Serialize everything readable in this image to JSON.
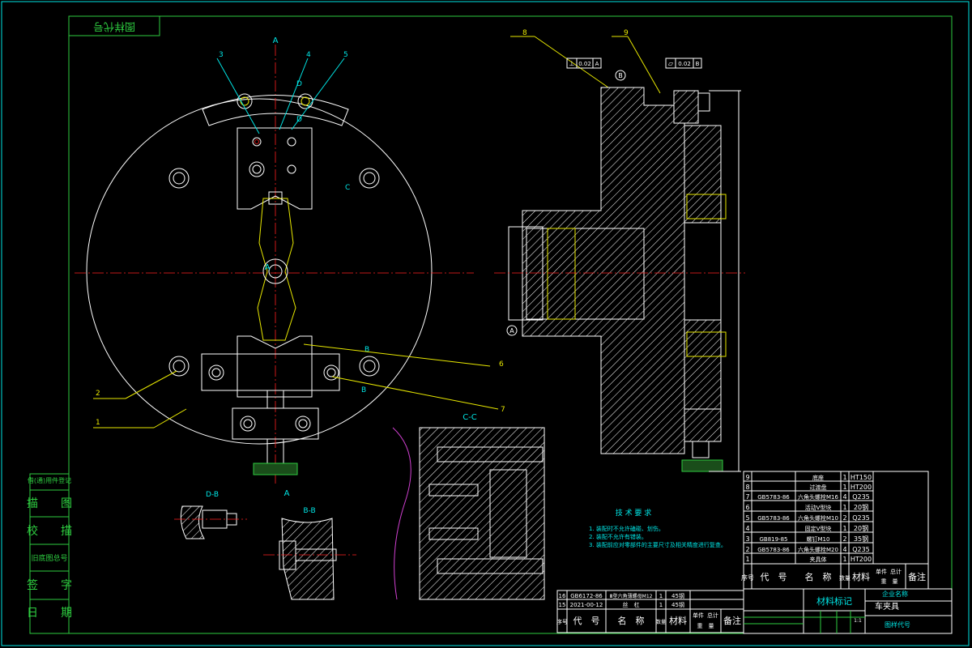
{
  "title_stamp": "图样代号",
  "view_labels": {
    "a_top": "A",
    "a_bottom": "A",
    "a_center": "A",
    "d_upper": "D",
    "d_lower": "D",
    "c_mark": "C",
    "b_upper": "B",
    "b_lower": "B",
    "section_cc": "C-C",
    "section_bb": "B-B",
    "section_db": "D-B",
    "datum_b": "B",
    "datum_a": "A"
  },
  "balloons": [
    "1",
    "2",
    "3",
    "4",
    "5",
    "6",
    "7",
    "8",
    "9"
  ],
  "tolerance_frames": [
    {
      "symbol": "⊥",
      "value": "0.02",
      "datum": "A"
    },
    {
      "symbol": "▱",
      "value": "0.02",
      "datum": "B"
    }
  ],
  "left_column": [
    {
      "label": "借(通)用件登记"
    },
    {
      "label": "描　　图"
    },
    {
      "label": "校　　描"
    },
    {
      "label": "旧底图总号"
    },
    {
      "label": "签　　字"
    },
    {
      "label": "日　　期"
    }
  ],
  "tech_req": {
    "heading": "技 术 要 求",
    "items": [
      "1. 装配时不允许磕碰、划伤。",
      "2. 装配不允许有错装。",
      "3. 装配前应对零部件的主要尺寸及相关精度进行复查。"
    ]
  },
  "bom_main": {
    "rows": [
      {
        "no": "9",
        "code": "",
        "name": "底座",
        "qty": "1",
        "material": "HT150"
      },
      {
        "no": "8",
        "code": "",
        "name": "过渡盘",
        "qty": "1",
        "material": "HT200"
      },
      {
        "no": "7",
        "code": "GB5783-86",
        "name": "六角头螺栓M16",
        "qty": "4",
        "material": "Q235"
      },
      {
        "no": "6",
        "code": "",
        "name": "活动V型块",
        "qty": "1",
        "material": "20钢"
      },
      {
        "no": "5",
        "code": "GB5783-86",
        "name": "六角头螺栓M10",
        "qty": "2",
        "material": "Q235"
      },
      {
        "no": "4",
        "code": "",
        "name": "固定V型块",
        "qty": "1",
        "material": "20钢"
      },
      {
        "no": "3",
        "code": "GB819-85",
        "name": "螺钉M10",
        "qty": "2",
        "material": "35钢"
      },
      {
        "no": "2",
        "code": "GB5783-86",
        "name": "六角头螺栓M20",
        "qty": "4",
        "material": "Q235"
      },
      {
        "no": "1",
        "code": "",
        "name": "夹具体",
        "qty": "1",
        "material": "HT200"
      }
    ],
    "header": {
      "no": "序号",
      "code": "代　号",
      "name": "名　称",
      "qty": "数量",
      "material": "材料",
      "unit_weight": "单件",
      "total_weight": "总计",
      "weight": "重　量",
      "remark": "备注"
    }
  },
  "bom_small": {
    "rows": [
      {
        "no": "16",
        "code": "GB6172-86",
        "name": "Ⅲ型六角薄螺母M12",
        "qty": "1",
        "material": "45钢"
      },
      {
        "no": "15",
        "code": "2021-00-12",
        "name": "丝　杠",
        "qty": "1",
        "material": "45钢"
      }
    ],
    "header": {
      "no": "序号",
      "code": "代　号",
      "name": "名　称",
      "qty": "数量",
      "material": "材料",
      "unit_weight": "单件",
      "total_weight": "总计",
      "weight": "重　量",
      "remark": "备注"
    }
  },
  "title_block": {
    "material_mark": "材料标记",
    "company": "企业名称",
    "drawing_name": "车夹具",
    "drawing_code": "图样代号",
    "scale": "1:1"
  }
}
